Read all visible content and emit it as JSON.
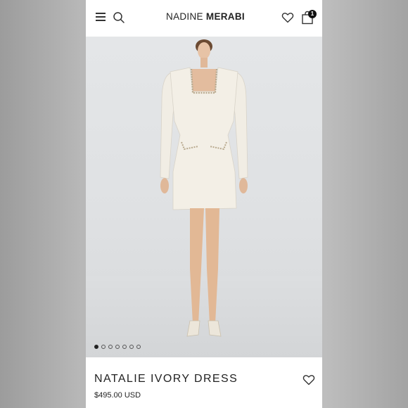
{
  "header": {
    "brand_light": "NADINE",
    "brand_bold": "MERABI",
    "cart_count": "1",
    "icons": [
      "menu-icon",
      "search-icon",
      "heart-icon",
      "shopping-bag-icon"
    ]
  },
  "gallery": {
    "dot_count": 7,
    "active_index": 0
  },
  "product": {
    "name": "NATALIE IVORY DRESS",
    "price": "$495.00 USD"
  },
  "colors": {
    "background": "#ffffff",
    "text": "#222222",
    "badge": "#111111"
  }
}
